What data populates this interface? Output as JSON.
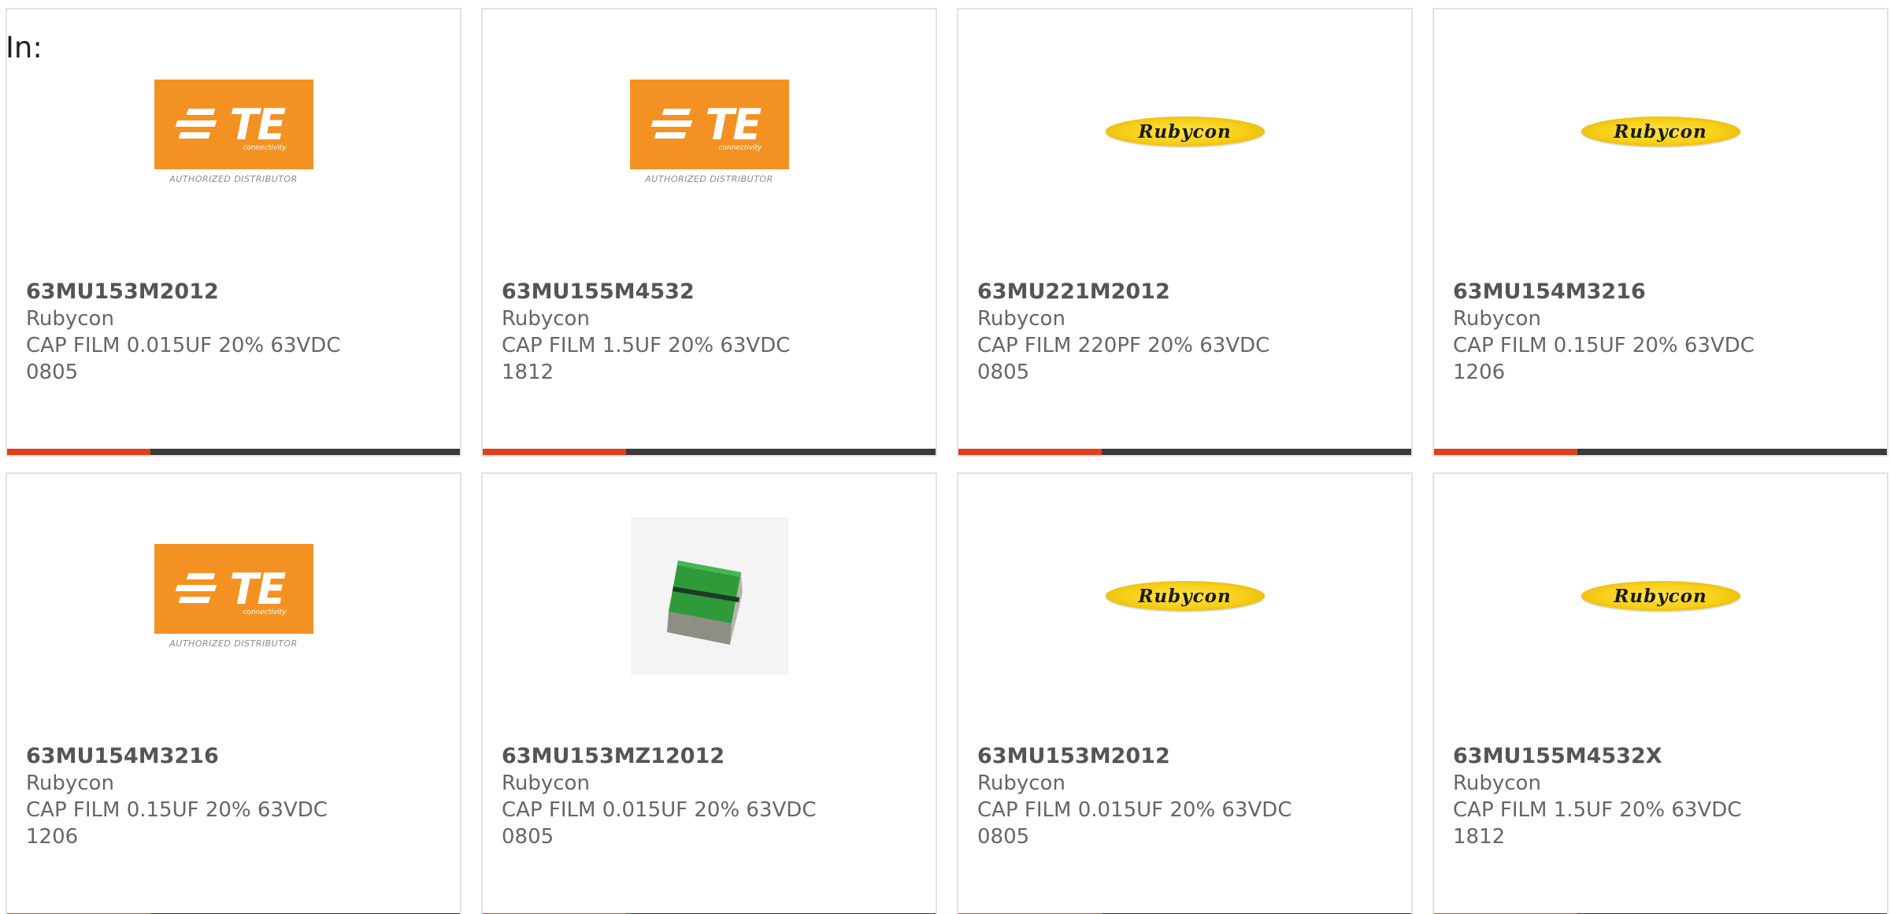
{
  "search": {
    "label": "In:"
  },
  "brand": {
    "accent": "#e2401c",
    "bar": "#3a3a3a",
    "te_orange": "#f39223",
    "rubycon_yellow": "#f7cf17"
  },
  "te_logo": {
    "wordmark": "TE",
    "subtitle": "connectivity",
    "caption": "AUTHORIZED DISTRIBUTOR"
  },
  "rubycon_logo": {
    "wordmark": "Rubycon"
  },
  "products": [
    {
      "image": "te-logo",
      "part": "63MU153M2012",
      "maker": "Rubycon",
      "desc": "CAP FILM 0.015UF 20% 63VDC",
      "package": "0805"
    },
    {
      "image": "te-logo",
      "part": "63MU155M4532",
      "maker": "Rubycon",
      "desc": "CAP FILM 1.5UF 20% 63VDC",
      "package": "1812"
    },
    {
      "image": "rubycon-logo",
      "part": "63MU221M2012",
      "maker": "Rubycon",
      "desc": "CAP FILM 220PF 20% 63VDC",
      "package": "0805"
    },
    {
      "image": "rubycon-logo",
      "part": "63MU154M3216",
      "maker": "Rubycon",
      "desc": "CAP FILM 0.15UF 20% 63VDC",
      "package": "1206"
    },
    {
      "image": "te-logo",
      "part": "63MU154M3216",
      "maker": "Rubycon",
      "desc": "CAP FILM 0.15UF 20% 63VDC",
      "package": "1206"
    },
    {
      "image": "chip-photo",
      "part": "63MU153MZ12012",
      "maker": "Rubycon",
      "desc": "CAP FILM 0.015UF 20% 63VDC",
      "package": "0805"
    },
    {
      "image": "rubycon-logo",
      "part": "63MU153M2012",
      "maker": "Rubycon",
      "desc": "CAP FILM 0.015UF 20% 63VDC",
      "package": "0805"
    },
    {
      "image": "rubycon-logo",
      "part": "63MU155M4532X",
      "maker": "Rubycon",
      "desc": "CAP FILM 1.5UF 20% 63VDC",
      "package": "1812"
    }
  ]
}
